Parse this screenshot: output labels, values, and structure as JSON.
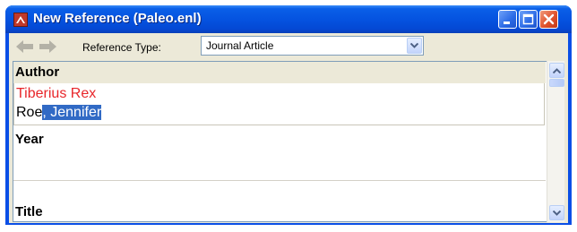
{
  "window": {
    "title": "New Reference (Paleo.enl)",
    "icon": "endnote-app-icon",
    "controls": [
      "minimize-icon",
      "maximize-icon",
      "close-icon"
    ]
  },
  "toolbar": {
    "back_icon": "back-arrow-icon",
    "forward_icon": "forward-arrow-icon",
    "reference_type_label": "Reference Type:",
    "reference_type_value": "Journal Article"
  },
  "fields": {
    "author": {
      "label": "Author",
      "lines": [
        {
          "text": "Tiberius Rex",
          "color": "#e8262a"
        },
        {
          "text_plain": "Roe",
          "text_selected": ", Jennifer"
        }
      ]
    },
    "year": {
      "label": "Year",
      "value": ""
    },
    "title": {
      "label": "Title",
      "value": ""
    }
  },
  "colors": {
    "titlebar": "#0553e0",
    "selection": "#316ac5",
    "new_author_text": "#e8262a",
    "window_bg": "#ece9d8"
  }
}
